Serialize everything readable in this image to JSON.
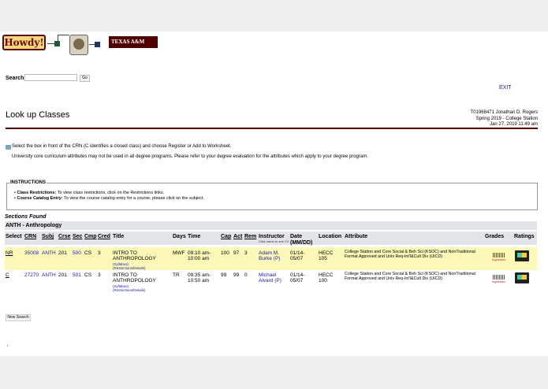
{
  "header": {
    "howdy_logo": "Howdy!",
    "tamu_logo": "TEXAS A&M"
  },
  "search": {
    "label": "Search",
    "value": "",
    "go_label": "Go"
  },
  "exit_label": "EXIT",
  "page_title": "Look up Classes",
  "user_info": {
    "line1": "T01968471 Jonathan D. Rogers",
    "line2": "Spring 2019 - College Station",
    "line3": "Jan 27, 2019 11:49 am"
  },
  "tips": {
    "line1": "Select the box in front of the CRN (C identifies a closed class) and choose Register or Add to Worksheet.",
    "line2": "University core curriculum attributes may not be used in all degree programs. Please refer to your degree evaluation for the attributes which apply to your degree program."
  },
  "instructions": {
    "title": "INSTRUCTIONS",
    "items": [
      {
        "bold": "Class Restrictions:",
        "text": " To view class restrictions, click on the Restrictions links."
      },
      {
        "bold": "Course Catalog Entry:",
        "text": " To view the course catalog entry for a course, please click on the subject."
      }
    ]
  },
  "sections_found_label": "Sections Found",
  "subject_header": "ANTH - Anthropology",
  "columns": {
    "select": "Select",
    "crn": "CRN",
    "subj": "Subj",
    "crse": "Crse",
    "sec": "Sec",
    "cmp": "Cmp",
    "cred": "Cred",
    "title": "Title",
    "days": "Days",
    "time": "Time",
    "cap": "Cap",
    "act": "Act",
    "rem": "Rem",
    "instructor": "Instructor",
    "instructor_hint": "Click name to see CV",
    "date": "Date",
    "date_format": "(MM/DD)",
    "location": "Location",
    "attribute": "Attribute",
    "grades": "Grades",
    "ratings": "Ratings"
  },
  "rows": [
    {
      "select": "NR",
      "crn": "35008",
      "subj": "ANTH",
      "crse": "201",
      "sec": "500",
      "cmp": "CS",
      "cred": "3",
      "title1": "INTRO TO",
      "title2": "ANTHROPOLOGY",
      "syllabus": "(Syllabus)",
      "restrictions": "(Restrictions/Details)",
      "days": "MWF",
      "time1": "09:10 am-",
      "time2": "10:00 am",
      "cap": "100",
      "act": "97",
      "rem": "3",
      "instr1": "Adam M.",
      "instr2": "Burke (P)",
      "date1": "01/14-",
      "date2": "05/07",
      "loc1": "HECC",
      "loc2": "105",
      "attribute": "College Station and Core Social & Beh Sci (KSOC) and NonTraditional Format Approved and Univ Req-Int'l&Cult Div (UICD)",
      "grades_icon": "bar-chart-icon",
      "grades_label": "registration",
      "ratings_icon": "rating-icon"
    },
    {
      "select": "C",
      "crn": "27270",
      "subj": "ANTH",
      "crse": "201",
      "sec": "501",
      "cmp": "CS",
      "cred": "3",
      "title1": "INTRO TO",
      "title2": "ANTHROPOLOGY",
      "syllabus": "(Syllabus)",
      "restrictions": "(Restrictions/Details)",
      "days": "TR",
      "time1": "09:35 am-",
      "time2": "10:50 am",
      "cap": "99",
      "act": "99",
      "rem": "0",
      "instr1": "Michael",
      "instr2": "Alvard (P)",
      "date1": "01/14-",
      "date2": "05/07",
      "loc1": "HECC",
      "loc2": "100",
      "attribute": "College Station and Core Social & Beh Sci (KSOC) and NonTraditional Format Approved and Univ Req-Int'l&Cult Div (UICD)",
      "grades_icon": "bar-chart-icon",
      "grades_label": "registration",
      "ratings_icon": "rating-icon"
    }
  ],
  "new_search_label": "New Search",
  "footer_mark": "•",
  "colors": {
    "maroon": "#500000",
    "link": "#1a1aa6",
    "highlight_row": "#fbf8b8",
    "header_bar": "#e3e3ea"
  }
}
